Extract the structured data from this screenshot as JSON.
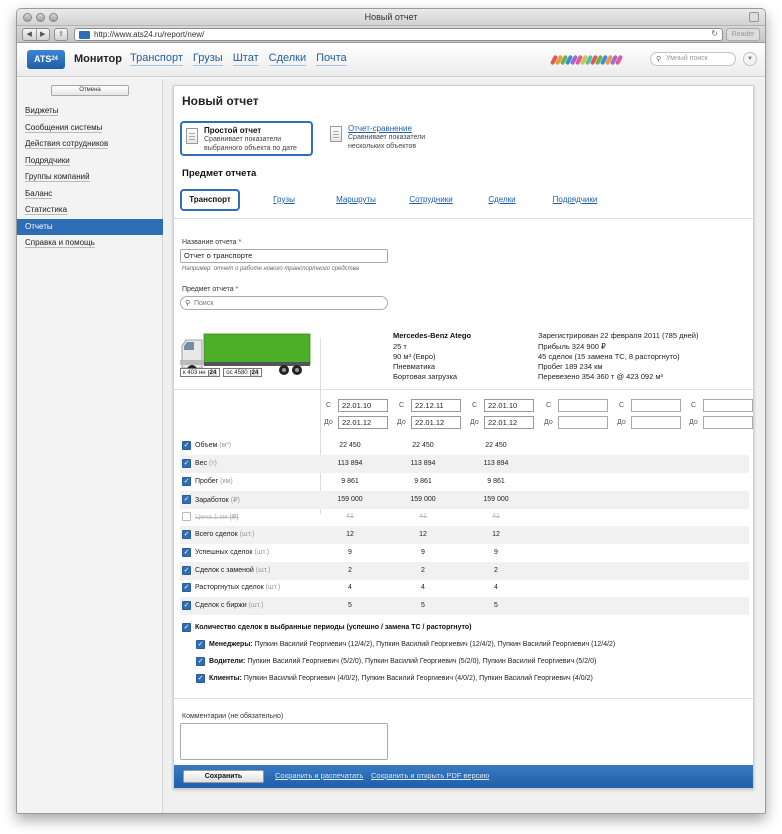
{
  "window": {
    "title": "Новый отчет",
    "url": "http://www.ats24.ru/report/new/",
    "reader_label": "Reader"
  },
  "header": {
    "logo": "ATS",
    "logo_sup": "24",
    "brand": "Монитор",
    "nav": [
      "Транспорт",
      "Грузы",
      "Штат",
      "Сделки",
      "Почта"
    ],
    "search_placeholder": "Умный поиск"
  },
  "sidebar": {
    "cancel_label": "Отмена",
    "items": [
      "Виджеты",
      "Сообщения системы",
      "Действия сотрудников",
      "Подрядчики",
      "Группы компаний",
      "Баланс",
      "Статистика",
      "Отчеты",
      "Справка и помощь"
    ],
    "active_index": 7
  },
  "page": {
    "title": "Новый отчет",
    "report_types": [
      {
        "title": "Простой отчет",
        "desc": "Сравнивает показатели выбранного объекта по дате"
      },
      {
        "title": "Отчет-сравнение",
        "desc": "Сравнивает показатели нескольких объектов"
      }
    ],
    "subject_title": "Предмет отчета",
    "subtabs": [
      "Транспорт",
      "Грузы",
      "Маршруты",
      "Сотрудники",
      "Сделки",
      "Подрядчики"
    ]
  },
  "form": {
    "name_label": "Название отчета",
    "required_mark": "*",
    "name_value": "Отчет о транспорте",
    "name_hint": "Например: отчет о работе нового транспортного средства",
    "subject_label": "Предмет отчета",
    "search_placeholder": "Поиск"
  },
  "vehicle": {
    "plate1": "к 403 нн",
    "plate1_region": "24",
    "plate2": "ос 4580",
    "plate2_region": "24",
    "name": "Mercedes-Benz Atego",
    "specs": [
      "25 т",
      "90 м³ (Евро)",
      "Пневматика",
      "Бортовая загрузка"
    ],
    "stats": [
      "Зарегистрирован 22 февраля 2011 (785 дней)",
      "Прибыль 324 900 ₽",
      "45 сделок (15 замена ТС, 8 расторгнуто)",
      "Пробег 189 234 км",
      "Перевезено 354 360 т @ 423 092 м³"
    ]
  },
  "periods": {
    "from_label": "С",
    "to_label": "До",
    "columns": [
      {
        "from": "22.01.10",
        "to": "22.01.12"
      },
      {
        "from": "22.12.11",
        "to": "22.01.12"
      },
      {
        "from": "22.01.10",
        "to": "22.01.12"
      },
      {
        "from": "",
        "to": ""
      },
      {
        "from": "",
        "to": ""
      },
      {
        "from": "",
        "to": ""
      }
    ]
  },
  "metrics": [
    {
      "name": "Объем",
      "unit": "(м³)",
      "checked": true,
      "values": [
        "22 450",
        "22 450",
        "22 450"
      ]
    },
    {
      "name": "Вес",
      "unit": "(т)",
      "checked": true,
      "values": [
        "113 894",
        "113 894",
        "113 894"
      ]
    },
    {
      "name": "Пробег",
      "unit": "(км)",
      "checked": true,
      "values": [
        "9 861",
        "9 861",
        "9 861"
      ]
    },
    {
      "name": "Заработок",
      "unit": "(₽)",
      "checked": true,
      "values": [
        "159 000",
        "159 000",
        "159 000"
      ]
    },
    {
      "name": "Цена 1 км",
      "unit": "(₽)",
      "checked": false,
      "values": [
        "41",
        "41",
        "41"
      ]
    },
    {
      "name": "Всего сделок",
      "unit": "(шт.)",
      "checked": true,
      "values": [
        "12",
        "12",
        "12"
      ]
    },
    {
      "name": "Успешных сделок",
      "unit": "(шт.)",
      "checked": true,
      "values": [
        "9",
        "9",
        "9"
      ]
    },
    {
      "name": "Сделок с заменой",
      "unit": "(шт.)",
      "checked": true,
      "values": [
        "2",
        "2",
        "2"
      ]
    },
    {
      "name": "Расторгнутых сделок",
      "unit": "(шт.)",
      "checked": true,
      "values": [
        "4",
        "4",
        "4"
      ]
    },
    {
      "name": "Сделок с биржи",
      "unit": "(шт.)",
      "checked": true,
      "values": [
        "5",
        "5",
        "5"
      ]
    }
  ],
  "counts": {
    "title": "Количество сделок в выбранные периоды (успешно / замена ТС / расторгнуто)",
    "rows": [
      {
        "label": "Менеджеры:",
        "text": "Пупкин Василий Георгиевич (12/4/2), Пупкин Василий Георгиевич (12/4/2), Пупкин Василий Георгиевич (12/4/2)"
      },
      {
        "label": "Водители:",
        "text": "Пупкин Василий Георгиевич (5/2/0), Пупкин Василий Георгиевич (5/2/0), Пупкин Василий Георгиевич (5/2/0)"
      },
      {
        "label": "Клиенты:",
        "text": "Пупкин Василий Георгиевич (4/0/2), Пупкин Василий Георгиевич (4/0/2), Пупкин Василий Георгиевич (4/0/2)"
      }
    ]
  },
  "comment": {
    "label": "Комментарии (не обязательно)"
  },
  "footer": {
    "save_label": "Сохранить",
    "print_label": "Сохранить и распечатать",
    "pdf_label": "Сохранить и открыть PDF версию"
  },
  "colors": {
    "accent": "#2d6db3",
    "link": "#1f5ea6",
    "truck_green": "#4caf2a"
  },
  "icons": {
    "back": "back-arrow-icon",
    "forward": "forward-arrow-icon",
    "reload": "reload-icon",
    "search": "search-icon",
    "checkbox": "checkmark-icon",
    "document": "document-icon"
  }
}
